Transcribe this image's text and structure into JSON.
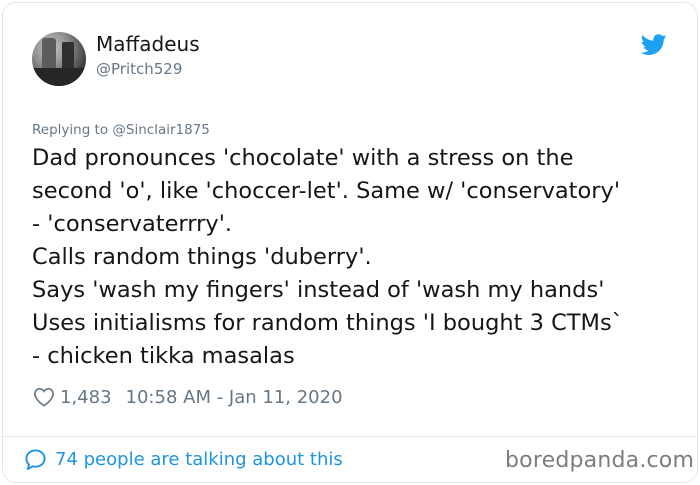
{
  "tweet": {
    "display_name": "Maffadeus",
    "handle": "@Pritch529",
    "replying_to": "Replying to @Sinclair1875",
    "text_lines": [
      "Dad pronounces 'chocolate' with a stress on the",
      "second 'o', like 'choccer-let'. Same w/ 'conservatory'",
      "- 'conservaterrry'.",
      "Calls random things 'duberry'.",
      "Says 'wash my fingers' instead of 'wash my hands'",
      "Uses initialisms for random things 'I bought 3 CTMs`",
      "- chicken tikka masalas"
    ],
    "likes": "1,483",
    "timestamp": "10:58 AM - Jan 11, 2020",
    "talking": "74 people are talking about this"
  },
  "icons": {
    "avatar": "avatar",
    "bird": "twitter-bird-icon",
    "heart": "heart-icon",
    "bubble": "speech-bubble-icon"
  },
  "colors": {
    "link_blue": "#1b95e0",
    "bird_blue": "#1da1f2",
    "muted": "#657786",
    "text": "#14171a"
  },
  "watermark": "boredpanda.com"
}
